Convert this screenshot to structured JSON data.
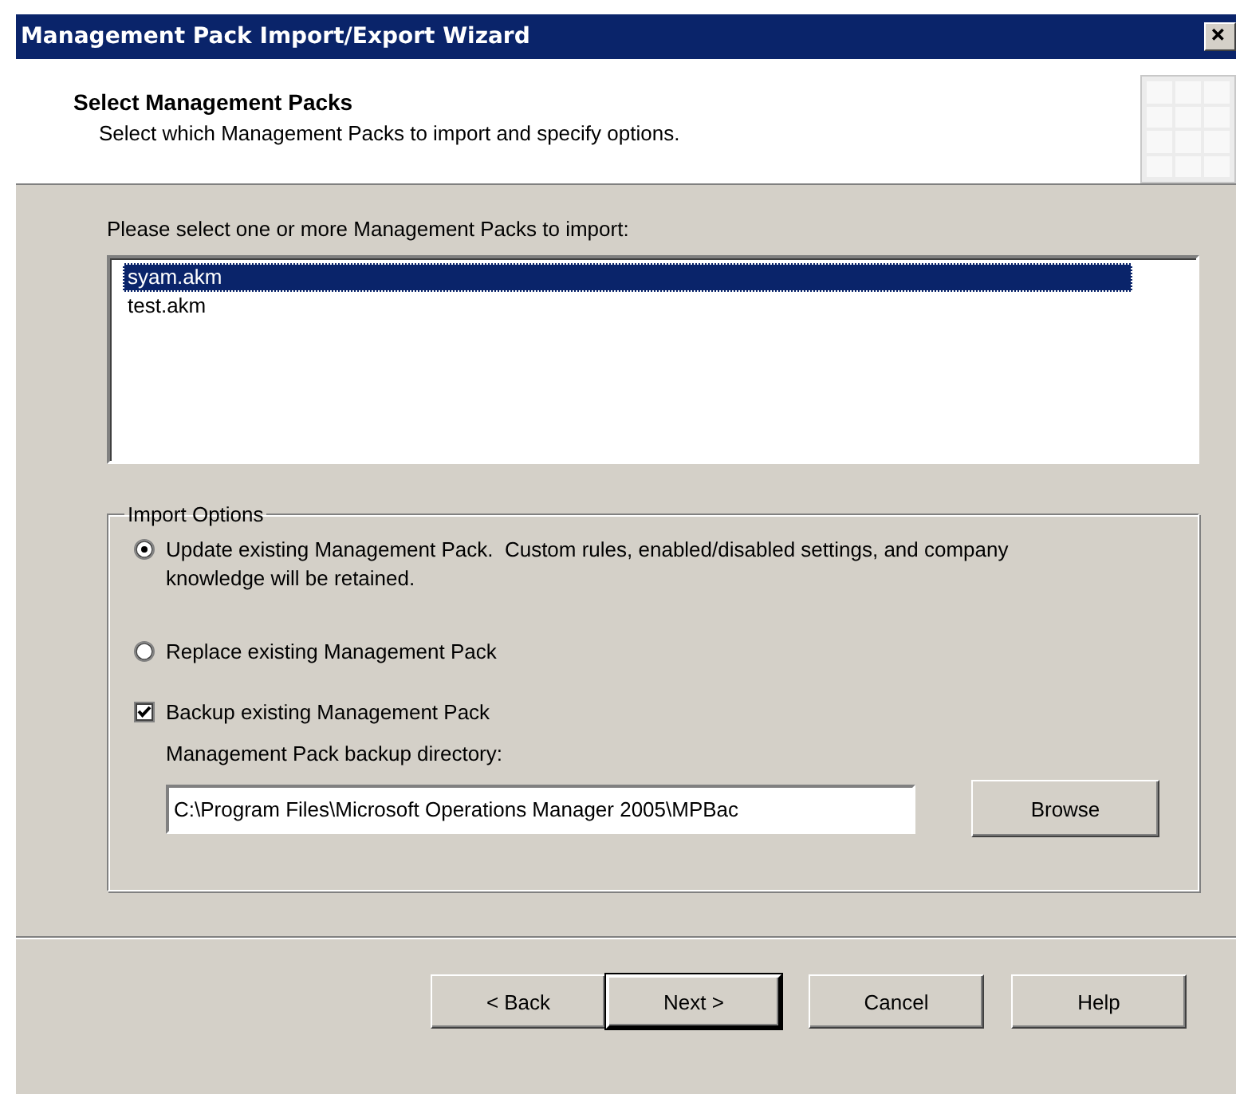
{
  "window": {
    "title": "Management Pack Import/Export Wizard"
  },
  "header": {
    "title": "Select Management Packs",
    "subtitle": "Select which Management Packs to import and specify options."
  },
  "pack_list": {
    "label": "Please select one or more Management Packs to import:",
    "items": [
      {
        "label": "syam.akm",
        "selected": true
      },
      {
        "label": "test.akm",
        "selected": false
      }
    ]
  },
  "import_options": {
    "title": "Import Options",
    "options": [
      {
        "kind": "radio",
        "label": "Update existing Management Pack.  Custom rules, enabled/disabled settings, and company knowledge will be retained.",
        "selected": true
      },
      {
        "kind": "radio",
        "label": "Replace existing Management Pack",
        "selected": false
      },
      {
        "kind": "checkbox",
        "label": "Backup existing Management Pack",
        "checked": true
      }
    ],
    "directory": {
      "label": "Management Pack backup directory:",
      "value": "C:\\Program Files\\Microsoft Operations Manager 2005\\MPBac",
      "button": "Browse"
    }
  },
  "buttons": [
    {
      "label": "< Back",
      "default": false
    },
    {
      "label": "Next >",
      "default": true
    },
    {
      "label": "Cancel",
      "default": false
    },
    {
      "label": "Help",
      "default": false
    }
  ]
}
